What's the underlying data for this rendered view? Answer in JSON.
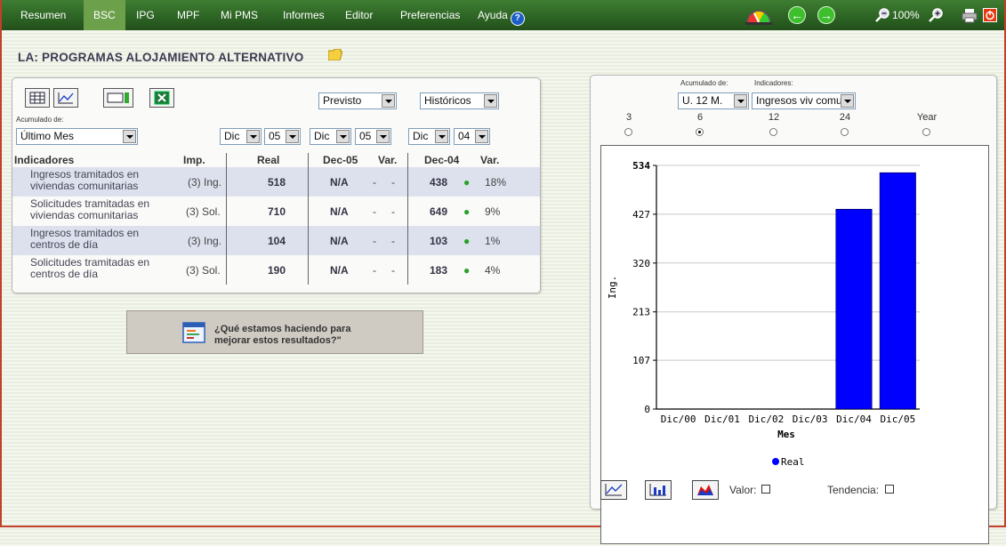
{
  "nav": {
    "items": [
      "Resumen",
      "BSC",
      "IPG",
      "MPF",
      "Mi PMS",
      "Informes",
      "Editor",
      "Preferencias",
      "Ayuda"
    ],
    "active": "BSC",
    "zoom": "100%"
  },
  "page_title": "LA: PROGRAMAS ALOJAMIENTO ALTERNATIVO",
  "left_panel": {
    "toolbar_icons": [
      "table-icon",
      "line-chart-icon",
      "gauge-icon",
      "excel-icon"
    ],
    "acumulado_label": "Acumulado de:",
    "acumulado_value": "Último Mes",
    "previsto": "Previsto",
    "historicos": "Históricos",
    "date_selects": [
      {
        "month": "Dic",
        "year": "05"
      },
      {
        "month": "Dic",
        "year": "05"
      },
      {
        "month": "Dic",
        "year": "04"
      }
    ],
    "headers": [
      "Indicadores",
      "Imp.",
      "Real",
      "Dec-05",
      "Var.",
      "Dec-04",
      "Var."
    ],
    "rows": [
      {
        "name": "Ingresos tramitados en viviendas comunitarias",
        "imp": "(3) Ing.",
        "real": "518",
        "prev": "N/A",
        "v1": "-",
        "v2": "-",
        "hist": "438",
        "pct": "18%"
      },
      {
        "name": "Solicitudes tramitadas en viviendas comunitarias",
        "imp": "(3) Sol.",
        "real": "710",
        "prev": "N/A",
        "v1": "-",
        "v2": "-",
        "hist": "649",
        "pct": "9%"
      },
      {
        "name": "Ingresos tramitados en centros de día",
        "imp": "(3) Ing.",
        "real": "104",
        "prev": "N/A",
        "v1": "-",
        "v2": "-",
        "hist": "103",
        "pct": "1%"
      },
      {
        "name": "Solicitudes tramitadas en centros de día",
        "imp": "(3) Sol.",
        "real": "190",
        "prev": "N/A",
        "v1": "-",
        "v2": "-",
        "hist": "183",
        "pct": "4%"
      }
    ],
    "action_button": {
      "line1": "¿Qué estamos haciendo para",
      "line2": "mejorar estos resultados?\""
    }
  },
  "right_panel": {
    "acumulado_label": "Acumulado de:",
    "acumulado_value": "U. 12 M.",
    "indicadores_label": "Indicadores:",
    "indicadores_value": "Ingresos viv comun",
    "periods": [
      "3",
      "6",
      "12",
      "24",
      "Year"
    ],
    "selected_period": "6",
    "valor_label": "Valor:",
    "tendencia_label": "Tendencia:"
  },
  "chart_data": {
    "type": "bar",
    "categories": [
      "Dic/00",
      "Dic/01",
      "Dic/02",
      "Dic/03",
      "Dic/04",
      "Dic/05"
    ],
    "series": [
      {
        "name": "Real",
        "values": [
          0,
          0,
          0,
          0,
          438,
          518
        ]
      }
    ],
    "ylabel": "Ing.",
    "xlabel": "Mes",
    "yticks": [
      "0",
      "107",
      "213",
      "320",
      "427",
      "534"
    ],
    "ylim": [
      0,
      534
    ],
    "legend": "bottom",
    "bar_color": "#0000ff"
  }
}
